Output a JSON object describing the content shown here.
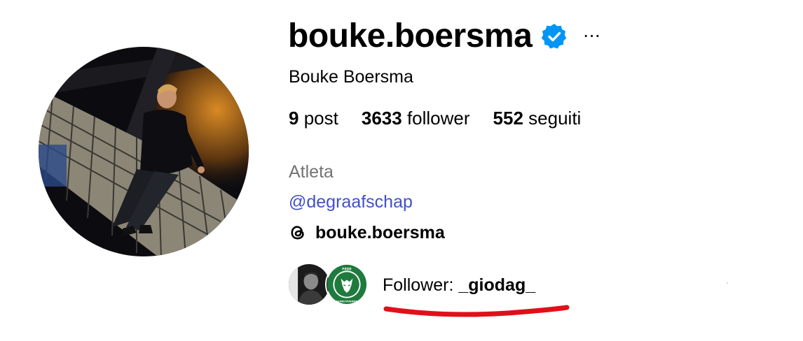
{
  "profile": {
    "username": "bouke.boersma",
    "full_name": "Bouke Boersma",
    "verified_icon": "verified-badge-icon",
    "more_icon": "more-options-icon",
    "more_label": "···"
  },
  "stats": {
    "posts_count": "9",
    "posts_label": "post",
    "followers_count": "3633",
    "followers_label": "follower",
    "following_count": "552",
    "following_label": "seguiti"
  },
  "bio": {
    "category": "Atleta",
    "mention": "@degraafschap",
    "threads_icon": "threads-logo-icon",
    "threads_handle": "bouke.boersma"
  },
  "followed_by": {
    "prefix": "Follower:",
    "name": "_giodag_",
    "avatar_2_text_top": "FEDE",
    "avatar_2_text_bottom": "BIANCOVERDE"
  },
  "colors": {
    "verified_blue": "#0095f6",
    "mention_blue": "#4150c8",
    "category_gray": "#737373",
    "annotation_red": "#e0101a"
  }
}
